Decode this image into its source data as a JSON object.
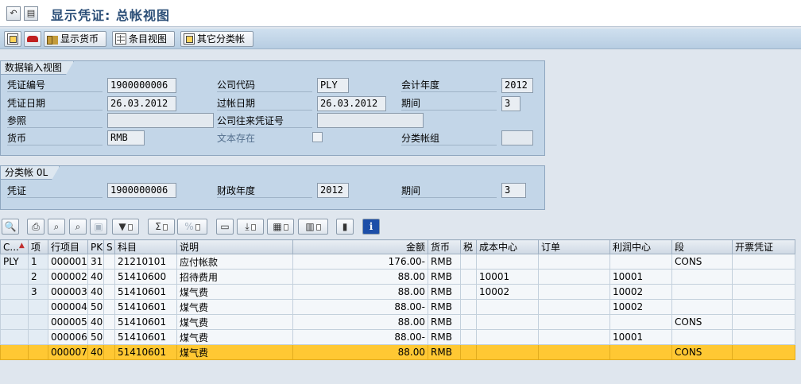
{
  "window": {
    "title": "显示凭证: 总帐视图",
    "icons": [
      "arrow-back-icon",
      "menu-icon"
    ]
  },
  "app_toolbar": {
    "buttons": [
      {
        "icon": "copy-icon",
        "label": ""
      },
      {
        "icon": "car-icon",
        "label": ""
      },
      {
        "icon": "people-icon",
        "label": "显示货币"
      },
      {
        "icon": "table-icon",
        "label": "条目视图"
      },
      {
        "icon": "copy-icon",
        "label": "其它分类帐"
      }
    ]
  },
  "entry_view": {
    "title": "数据输入视图",
    "doc_number_label": "凭证编号",
    "doc_number": "1900000006",
    "company_code_label": "公司代码",
    "company_code": "PLY",
    "fiscal_year_label": "会计年度",
    "fiscal_year": "2012",
    "doc_date_label": "凭证日期",
    "doc_date": "26.03.2012",
    "posting_date_label": "过帐日期",
    "posting_date": "26.03.2012",
    "period_label": "期间",
    "period": "3",
    "reference_label": "参照",
    "reference": "",
    "cross_cc_label": "公司往来凭证号",
    "cross_cc": "",
    "currency_label": "货币",
    "currency": "RMB",
    "text_exists_label": "文本存在",
    "text_exists": false,
    "ledger_group_label": "分类帐组",
    "ledger_group": ""
  },
  "ledger_view": {
    "title": "分类帐 0L",
    "doc_label": "凭证",
    "doc": "1900000006",
    "fiscal_year_label": "财政年度",
    "fiscal_year": "2012",
    "period_label": "期间",
    "period": "3"
  },
  "alv_toolbar": {
    "buttons": [
      "details-icon",
      "print-icon",
      "filter-icon",
      "find-icon",
      "lock-icon",
      "filter-set-icon",
      "sum-icon",
      "subtotal-icon",
      "print-preview-icon",
      "export-icon",
      "spreadsheet-icon",
      "layout-icon",
      "graphic-icon",
      "info-icon"
    ]
  },
  "table": {
    "columns": [
      "C...",
      "项",
      "行项目",
      "PK",
      "S",
      "科目",
      "说明",
      "金额",
      "货币",
      "税",
      "成本中心",
      "订单",
      "利润中心",
      "段",
      "开票凭证"
    ],
    "rows": [
      {
        "c": "PLY",
        "item": "1",
        "line": "000001",
        "pk": "31",
        "s": "",
        "account": "21210101",
        "desc": "应付帐款",
        "amount": "176.00-",
        "curr": "RMB",
        "tax": "",
        "cost_center": "",
        "order": "",
        "profit_center": "",
        "segment": "CONS",
        "billing": "",
        "selected": false
      },
      {
        "c": "",
        "item": "2",
        "line": "000002",
        "pk": "40",
        "s": "",
        "account": "51410600",
        "desc": "招待费用",
        "amount": "88.00",
        "curr": "RMB",
        "tax": "",
        "cost_center": "10001",
        "order": "",
        "profit_center": "10001",
        "segment": "",
        "billing": "",
        "selected": false
      },
      {
        "c": "",
        "item": "3",
        "line": "000003",
        "pk": "40",
        "s": "",
        "account": "51410601",
        "desc": "煤气费",
        "amount": "88.00",
        "curr": "RMB",
        "tax": "",
        "cost_center": "10002",
        "order": "",
        "profit_center": "10002",
        "segment": "",
        "billing": "",
        "selected": false
      },
      {
        "c": "",
        "item": "",
        "line": "000004",
        "pk": "50",
        "s": "",
        "account": "51410601",
        "desc": "煤气费",
        "amount": "88.00-",
        "curr": "RMB",
        "tax": "",
        "cost_center": "",
        "order": "",
        "profit_center": "10002",
        "segment": "",
        "billing": "",
        "selected": false
      },
      {
        "c": "",
        "item": "",
        "line": "000005",
        "pk": "40",
        "s": "",
        "account": "51410601",
        "desc": "煤气费",
        "amount": "88.00",
        "curr": "RMB",
        "tax": "",
        "cost_center": "",
        "order": "",
        "profit_center": "",
        "segment": "CONS",
        "billing": "",
        "selected": false
      },
      {
        "c": "",
        "item": "",
        "line": "000006",
        "pk": "50",
        "s": "",
        "account": "51410601",
        "desc": "煤气费",
        "amount": "88.00-",
        "curr": "RMB",
        "tax": "",
        "cost_center": "",
        "order": "",
        "profit_center": "10001",
        "segment": "",
        "billing": "",
        "selected": false
      },
      {
        "c": "",
        "item": "",
        "line": "000007",
        "pk": "40",
        "s": "",
        "account": "51410601",
        "desc": "煤气费",
        "amount": "88.00",
        "curr": "RMB",
        "tax": "",
        "cost_center": "",
        "order": "",
        "profit_center": "",
        "segment": "CONS",
        "billing": "",
        "selected": true
      }
    ]
  },
  "colors": {
    "selected_row": "#ffc833",
    "group_bg": "#c3d6e8",
    "title_text": "#2c4f78"
  }
}
